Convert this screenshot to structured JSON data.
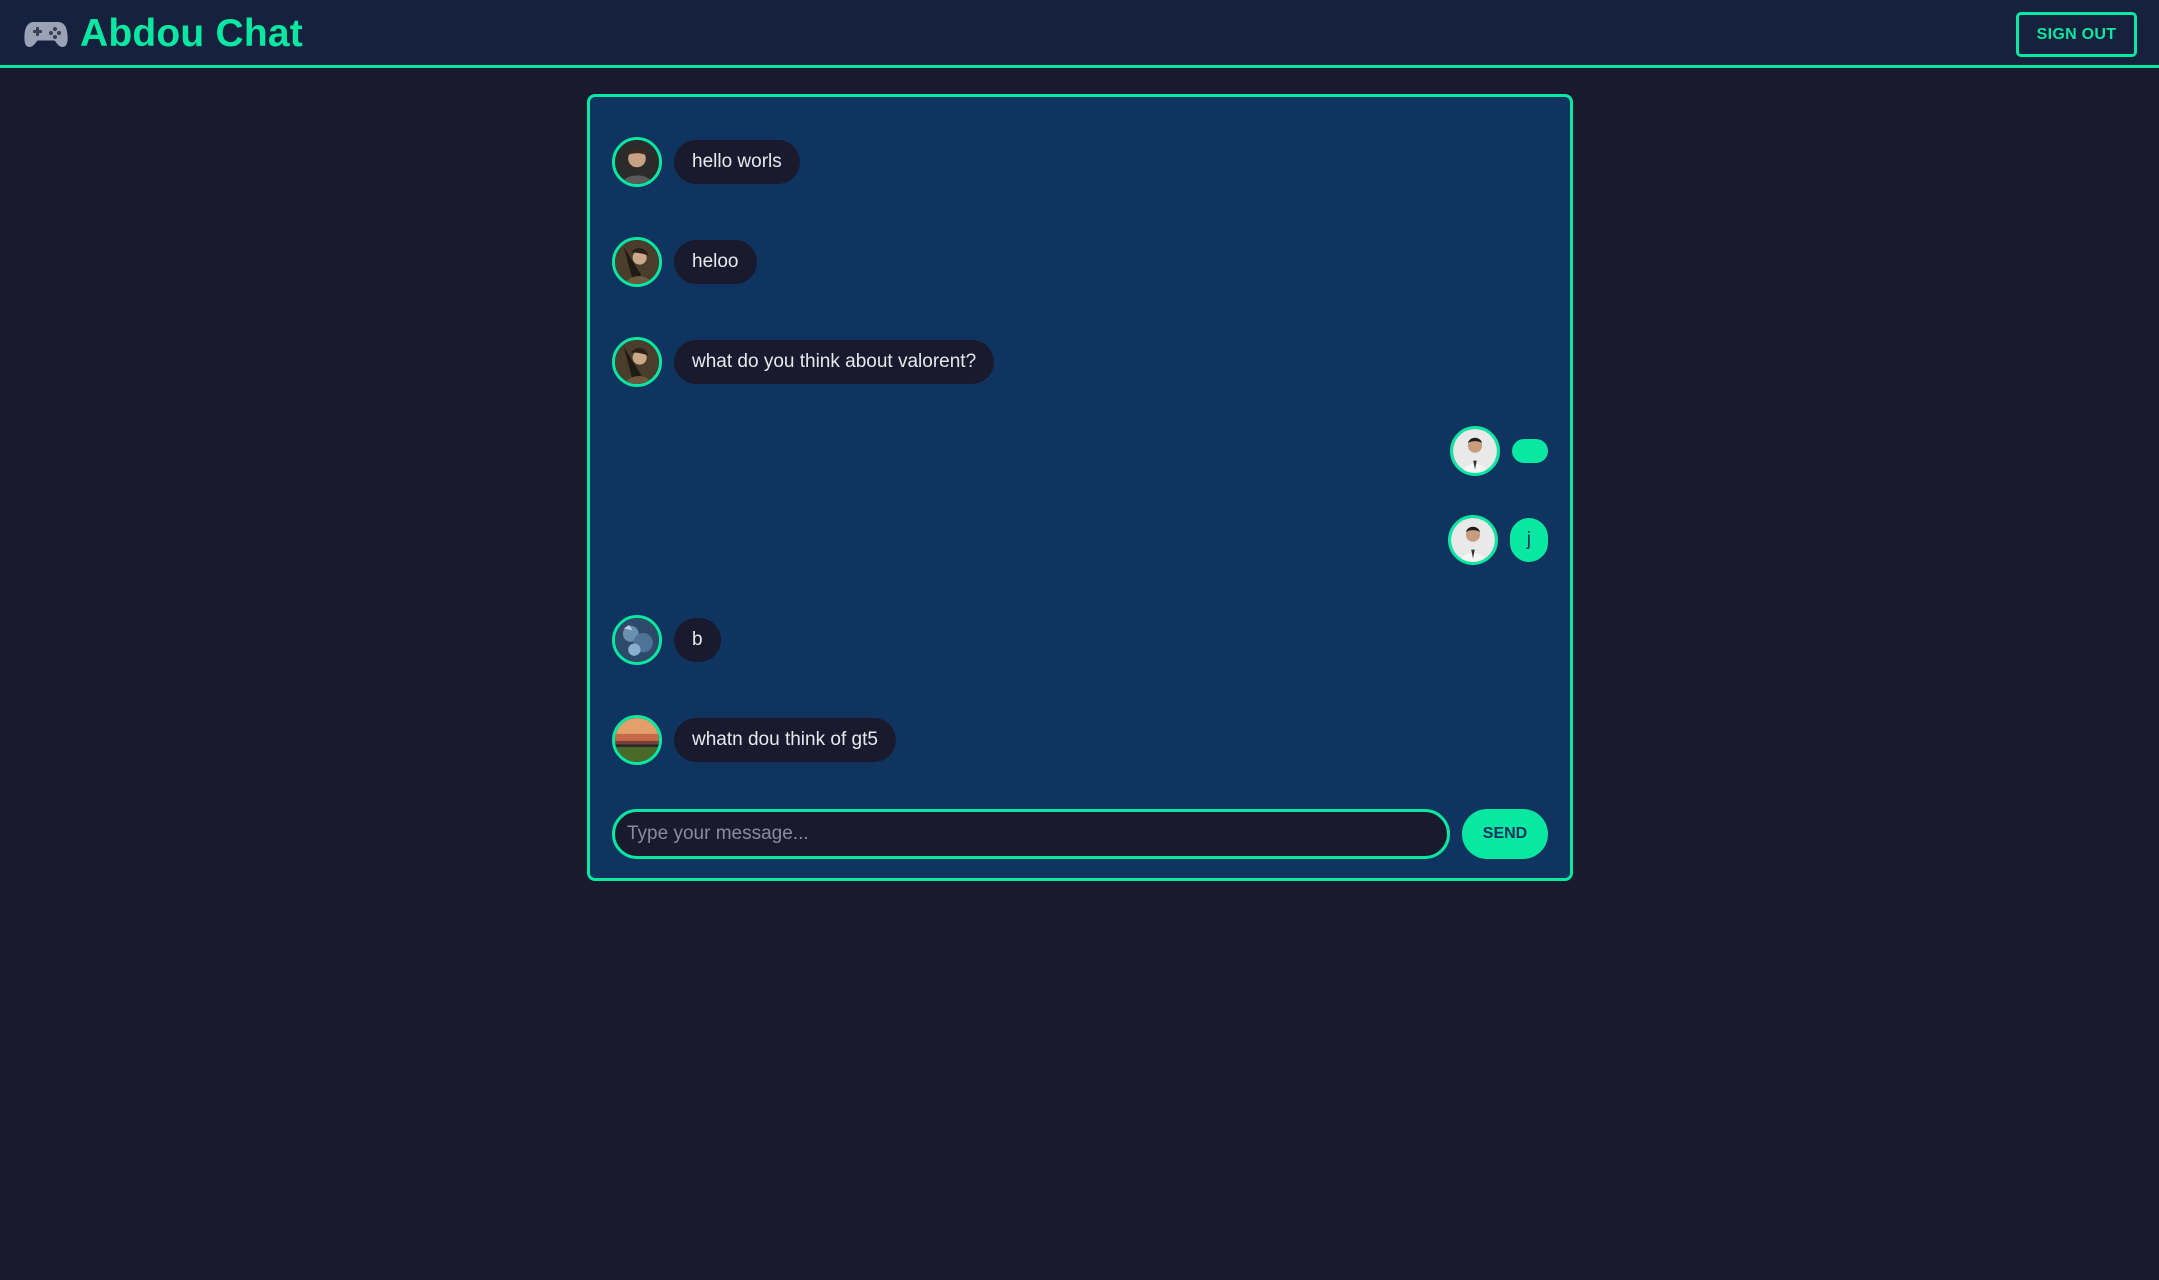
{
  "app": {
    "title": "Abdou Chat",
    "logo_icon": "game-controller-icon"
  },
  "header": {
    "signout_label": "SIGN OUT"
  },
  "colors": {
    "accent": "#08e8a0",
    "page_bg": "#1a1a2e",
    "header_bg": "#16213e",
    "panel_bg": "#0f3460",
    "received_bubble": "#1a1a2e"
  },
  "messages": [
    {
      "text": "hello worls",
      "side": "received",
      "avatar_icon": "user-avatar-icon"
    },
    {
      "text": "heloo",
      "side": "received",
      "avatar_icon": "user-avatar-icon"
    },
    {
      "text": "what do you think about valorent?",
      "side": "received",
      "avatar_icon": "user-avatar-icon"
    },
    {
      "text": "",
      "side": "sent",
      "avatar_icon": "user-avatar-icon"
    },
    {
      "text": "j",
      "side": "sent",
      "avatar_icon": "user-avatar-icon"
    },
    {
      "text": "b",
      "side": "received",
      "avatar_icon": "user-avatar-icon"
    },
    {
      "text": "whatn dou think of gt5",
      "side": "received",
      "avatar_icon": "user-avatar-icon"
    }
  ],
  "composer": {
    "placeholder": "Type your message...",
    "value": "",
    "send_label": "SEND"
  }
}
